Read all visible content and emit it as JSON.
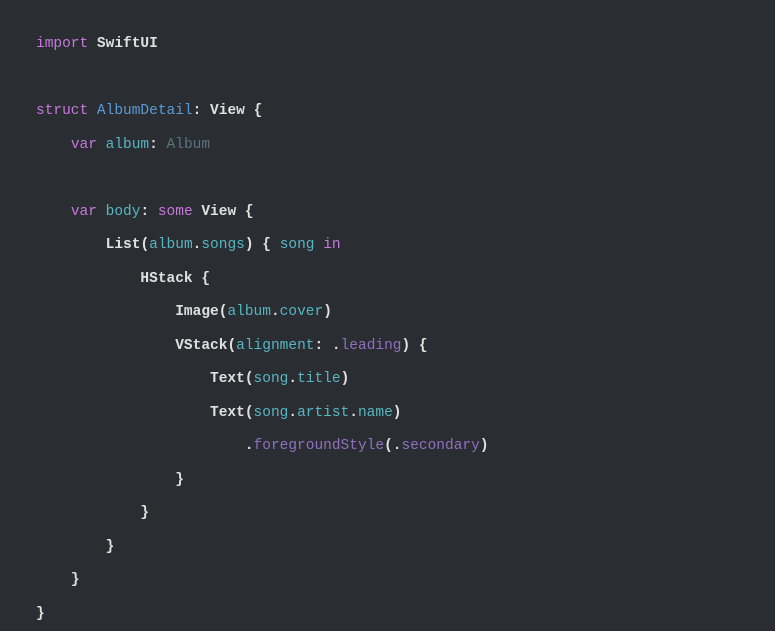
{
  "code": {
    "l1": {
      "import": "import",
      "module": "SwiftUI"
    },
    "l3": {
      "struct": "struct",
      "name": "AlbumDetail",
      "colon": ":",
      "protocol": "View",
      "brace": "{"
    },
    "l4": {
      "var": "var",
      "name": "album",
      "colon": ":",
      "type": "Album"
    },
    "l6": {
      "var": "var",
      "name": "body",
      "colon": ":",
      "some": "some",
      "type": "View",
      "brace": "{"
    },
    "l7": {
      "list": "List",
      "lp": "(",
      "album": "album",
      "dot": ".",
      "songs": "songs",
      "rp": ")",
      "lb": "{",
      "song": "song",
      "in": "in"
    },
    "l8": {
      "hstack": "HStack",
      "brace": "{"
    },
    "l9": {
      "image": "Image",
      "lp": "(",
      "album": "album",
      "dot": ".",
      "cover": "cover",
      "rp": ")"
    },
    "l10": {
      "vstack": "VStack",
      "lp": "(",
      "label": "alignment",
      "colon": ":",
      "dot": ".",
      "case": "leading",
      "rp": ")",
      "brace": "{"
    },
    "l11": {
      "text": "Text",
      "lp": "(",
      "song": "song",
      "dot": ".",
      "title": "title",
      "rp": ")"
    },
    "l12": {
      "text": "Text",
      "lp": "(",
      "song": "song",
      "d1": ".",
      "artist": "artist",
      "d2": ".",
      "name": "name",
      "rp": ")"
    },
    "l13": {
      "dot": ".",
      "method": "foregroundStyle",
      "lp": "(",
      "d2": ".",
      "case": "secondary",
      "rp": ")"
    },
    "l14": {
      "brace": "}"
    },
    "l15": {
      "brace": "}"
    },
    "l16": {
      "brace": "}"
    },
    "l17": {
      "brace": "}"
    },
    "l18": {
      "brace": "}"
    }
  }
}
